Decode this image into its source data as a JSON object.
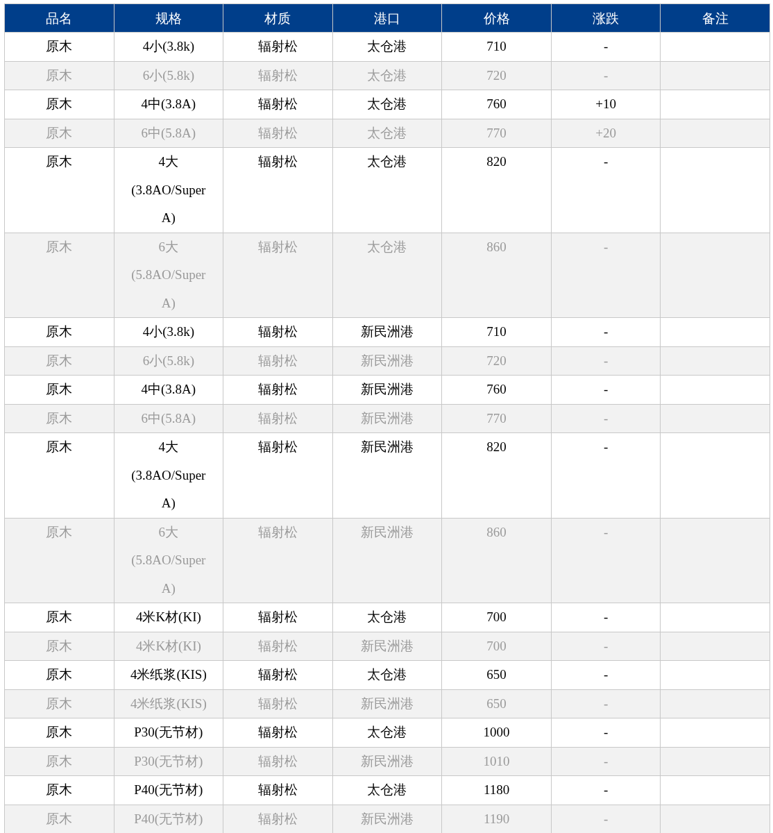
{
  "table": {
    "columns": [
      "品名",
      "规格",
      "材质",
      "港口",
      "价格",
      "涨跌",
      "备注"
    ],
    "rows": [
      {
        "cells": [
          "原木",
          "4小(3.8k)",
          "辐射松",
          "太仓港",
          "710",
          "-"
        ]
      },
      {
        "cells": [
          "原木",
          "6小(5.8k)",
          "辐射松",
          "太仓港",
          "720",
          "-"
        ]
      },
      {
        "cells": [
          "原木",
          "4中(3.8A)",
          "辐射松",
          "太仓港",
          "760",
          "+10"
        ]
      },
      {
        "cells": [
          "原木",
          "6中(5.8A)",
          "辐射松",
          "太仓港",
          "770",
          "+20"
        ]
      },
      {
        "cells": [
          "原木",
          "4大(3.8AO/Super A)",
          "辐射松",
          "太仓港",
          "820",
          "-"
        ]
      },
      {
        "cells": [
          "原木",
          "6大(5.8AO/Super A)",
          "辐射松",
          "太仓港",
          "860",
          "-"
        ]
      },
      {
        "cells": [
          "原木",
          "4小(3.8k)",
          "辐射松",
          "新民洲港",
          "710",
          "-"
        ]
      },
      {
        "cells": [
          "原木",
          "6小(5.8k)",
          "辐射松",
          "新民洲港",
          "720",
          "-"
        ]
      },
      {
        "cells": [
          "原木",
          "4中(3.8A)",
          "辐射松",
          "新民洲港",
          "760",
          "-"
        ]
      },
      {
        "cells": [
          "原木",
          "6中(5.8A)",
          "辐射松",
          "新民洲港",
          "770",
          "-"
        ]
      },
      {
        "cells": [
          "原木",
          "4大(3.8AO/Super A)",
          "辐射松",
          "新民洲港",
          "820",
          "-"
        ]
      },
      {
        "cells": [
          "原木",
          "6大(5.8AO/Super A)",
          "辐射松",
          "新民洲港",
          "860",
          "-"
        ]
      },
      {
        "cells": [
          "原木",
          "4米K材(KI)",
          "辐射松",
          "太仓港",
          "700",
          "-"
        ]
      },
      {
        "cells": [
          "原木",
          "4米K材(KI)",
          "辐射松",
          "新民洲港",
          "700",
          "-"
        ]
      },
      {
        "cells": [
          "原木",
          "4米纸浆(KIS)",
          "辐射松",
          "太仓港",
          "650",
          "-"
        ]
      },
      {
        "cells": [
          "原木",
          "4米纸浆(KIS)",
          "辐射松",
          "新民洲港",
          "650",
          "-"
        ]
      },
      {
        "cells": [
          "原木",
          "P30(无节材)",
          "辐射松",
          "太仓港",
          "1000",
          "-"
        ]
      },
      {
        "cells": [
          "原木",
          "P30(无节材)",
          "辐射松",
          "新民洲港",
          "1010",
          "-"
        ]
      },
      {
        "cells": [
          "原木",
          "P40(无节材)",
          "辐射松",
          "太仓港",
          "1180",
          "-"
        ]
      },
      {
        "cells": [
          "原木",
          "P40(无节材)",
          "辐射松",
          "新民洲港",
          "1190",
          "-"
        ]
      }
    ]
  }
}
